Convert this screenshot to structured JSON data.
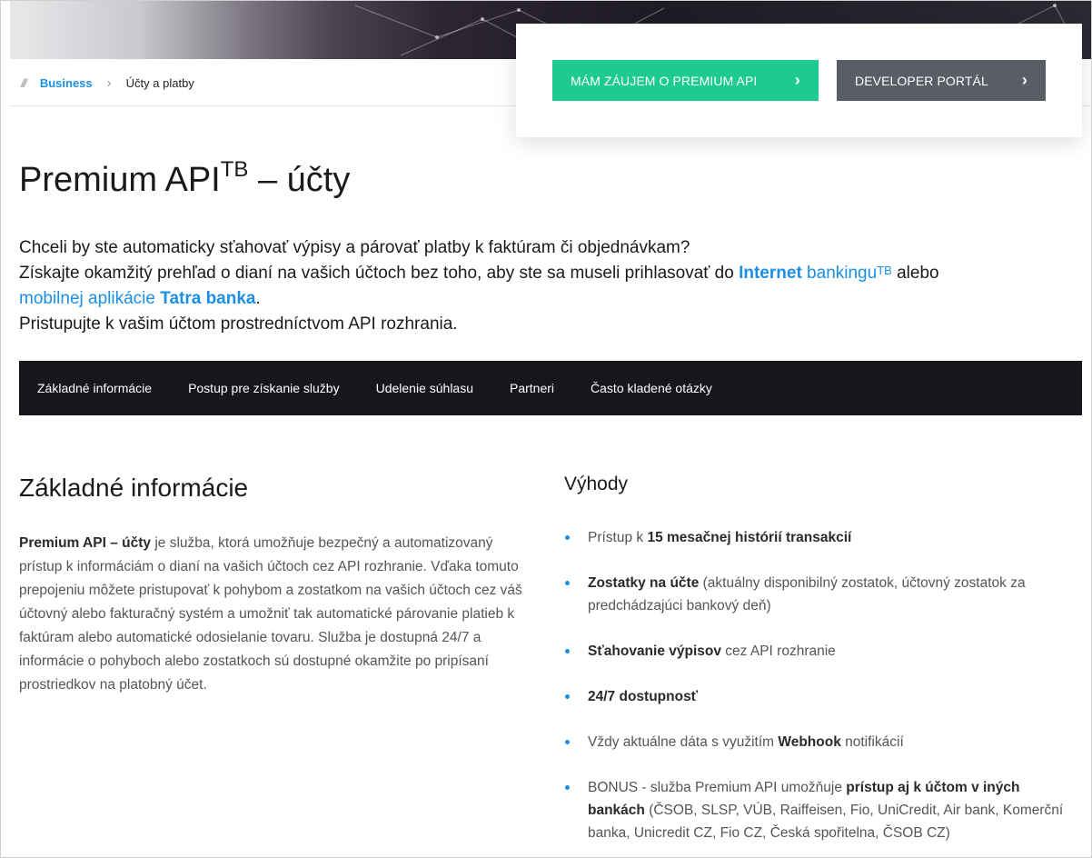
{
  "breadcrumb": {
    "slashes": "///",
    "items": [
      {
        "label": "Business"
      },
      {
        "label": "Účty a platby"
      }
    ],
    "separator": "›"
  },
  "cta": {
    "interest_label": "MÁM ZÁUJEM O PREMIUM API",
    "developer_label": "DEVELOPER PORTÁL",
    "chevron": "›"
  },
  "title": {
    "main": "Premium API",
    "sup": "TB",
    "rest": " – účty"
  },
  "intro": {
    "line1": "Chceli by ste automaticky sťahovať výpisy a párovať platby k faktúram či objednávkam?",
    "line2_a": "Získajte okamžitý prehľad o dianí na vašich účtoch bez toho, aby ste sa museli prihlasovať do ",
    "line2_link_bold": "Internet",
    "line2_link": " bankingu",
    "line2_link_sup": "TB",
    "line2_b": " alebo",
    "line3_link": "mobilnej aplikácie ",
    "line3_link_bold": "Tatra banka",
    "line3_end": ".",
    "line4": "Pristupujte k vašim účtom prostredníctvom API rozhrania."
  },
  "tabs": [
    {
      "label": "Základné informácie"
    },
    {
      "label": "Postup pre získanie služby"
    },
    {
      "label": "Udelenie súhlasu"
    },
    {
      "label": "Partneri"
    },
    {
      "label": "Často kladené otázky"
    }
  ],
  "basic": {
    "heading": "Základné informácie",
    "desc_bold": "Premium API – účty",
    "desc": " je služba, ktorá umožňuje bezpečný a automatizovaný prístup k informáciám o dianí na vašich účtoch cez API rozhranie. Vďaka tomuto prepojeniu môžete pristupovať k pohybom a zostatkom na vašich účtoch cez váš účtovný alebo fakturačný systém a umožniť tak automatické párovanie platieb k faktúram alebo automatické odosielanie tovaru. Služba je dostupná 24/7 a informácie o pohyboch alebo zostatkoch sú dostupné okamžite po pripísaní prostriedkov na platobný účet."
  },
  "advantages": {
    "heading": "Výhody",
    "items": [
      {
        "pre": "Prístup k ",
        "bold": "15 mesačnej histórií transakcií",
        "post": ""
      },
      {
        "pre": "",
        "bold": "Zostatky na účte",
        "post": " (aktuálny disponibilný zostatok, účtovný zostatok za predchádzajúci bankový deň)"
      },
      {
        "pre": "",
        "bold": "Sťahovanie výpisov",
        "post": " cez API rozhranie"
      },
      {
        "pre": "",
        "bold": "24/7 dostupnosť",
        "post": ""
      },
      {
        "pre": "Vždy aktuálne dáta s využitím ",
        "bold": "Webhook",
        "post": " notifikácií"
      },
      {
        "pre": "BONUS - služba Premium API umožňuje ",
        "bold": "prístup aj k účtom v iných bankách",
        "post": " (ČSOB, SLSP, VÚB, Raiffeisen, Fio, UniCredit, Air bank, Komerční banka, Unicredit CZ, Fio CZ, Česká spořitelna, ČSOB CZ)"
      }
    ]
  },
  "colors": {
    "accent_blue": "#1a8fe3",
    "cta_green": "#1ecb8e",
    "cta_gray": "#5b5d66",
    "tab_bar": "#16171c"
  }
}
